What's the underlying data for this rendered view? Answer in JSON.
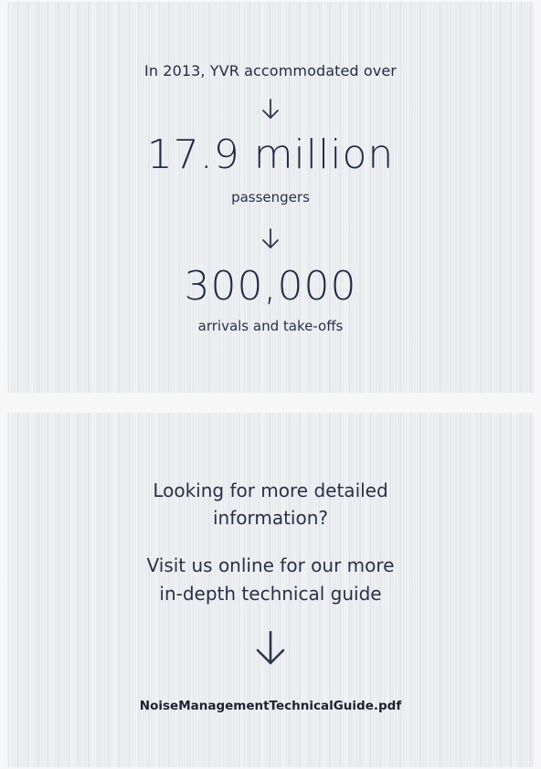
{
  "stats": {
    "intro": "In 2013, YVR accommodated over",
    "passengers_value": "17.9 million",
    "passengers_label": "passengers",
    "movements_value": "300,000",
    "movements_label": "arrivals and take-offs"
  },
  "info": {
    "question_line1": "Looking for more detailed",
    "question_line2": "information?",
    "visit_line1": "Visit us online for our more",
    "visit_line2": "in-depth technical guide",
    "pdf_link": "NoiseManagementTechnicalGuide.pdf"
  },
  "icons": {
    "arrow": "arrow-down-icon"
  }
}
